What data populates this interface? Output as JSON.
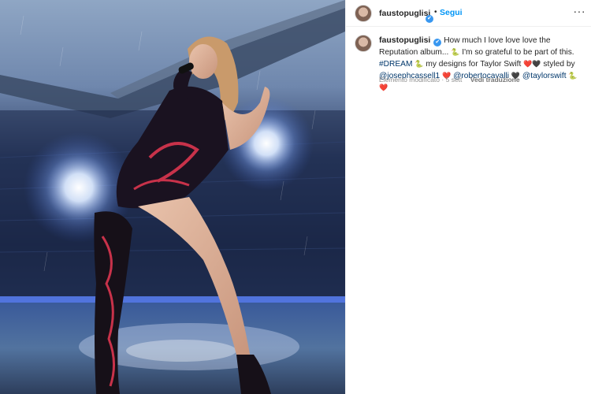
{
  "post": {
    "username": "faustopuglisi",
    "separator": "•",
    "follow_label": "Segui",
    "more_label": "···",
    "verified_mark": "✔"
  },
  "caption": {
    "username": "faustopuglisi",
    "text_1": "How much I love love love the Reputation album... ",
    "emoji_snake_1": "🐍",
    "text_2": " I'm so grateful to be part of this. ",
    "hashtag": "#DREAM",
    "emoji_snake_2": "🐍",
    "text_3": " my designs for Taylor Swift ",
    "emoji_hearts_1": "❤️🖤",
    "text_4": " styled by ",
    "mention_1": "@josephcassell1",
    "emoji_heart_2": "❤️",
    "mention_2": "@robertocavalli",
    "emoji_heart_3": "🖤",
    "mention_3": "@taylorswift",
    "emoji_snake_heart": "🐍❤️"
  },
  "meta": {
    "edited": "Elemento modificato",
    "separator": "·",
    "time": "5 sett",
    "translate_label": "Vedi traduzione"
  },
  "photo": {
    "subject": "performer in sequined bodysuit singing on rainy stadium stage",
    "colors": {
      "sky": "#8fa6c4",
      "crowd": "#1b2747",
      "spotlight": "#ffffff",
      "accent": "#0095f6"
    }
  }
}
